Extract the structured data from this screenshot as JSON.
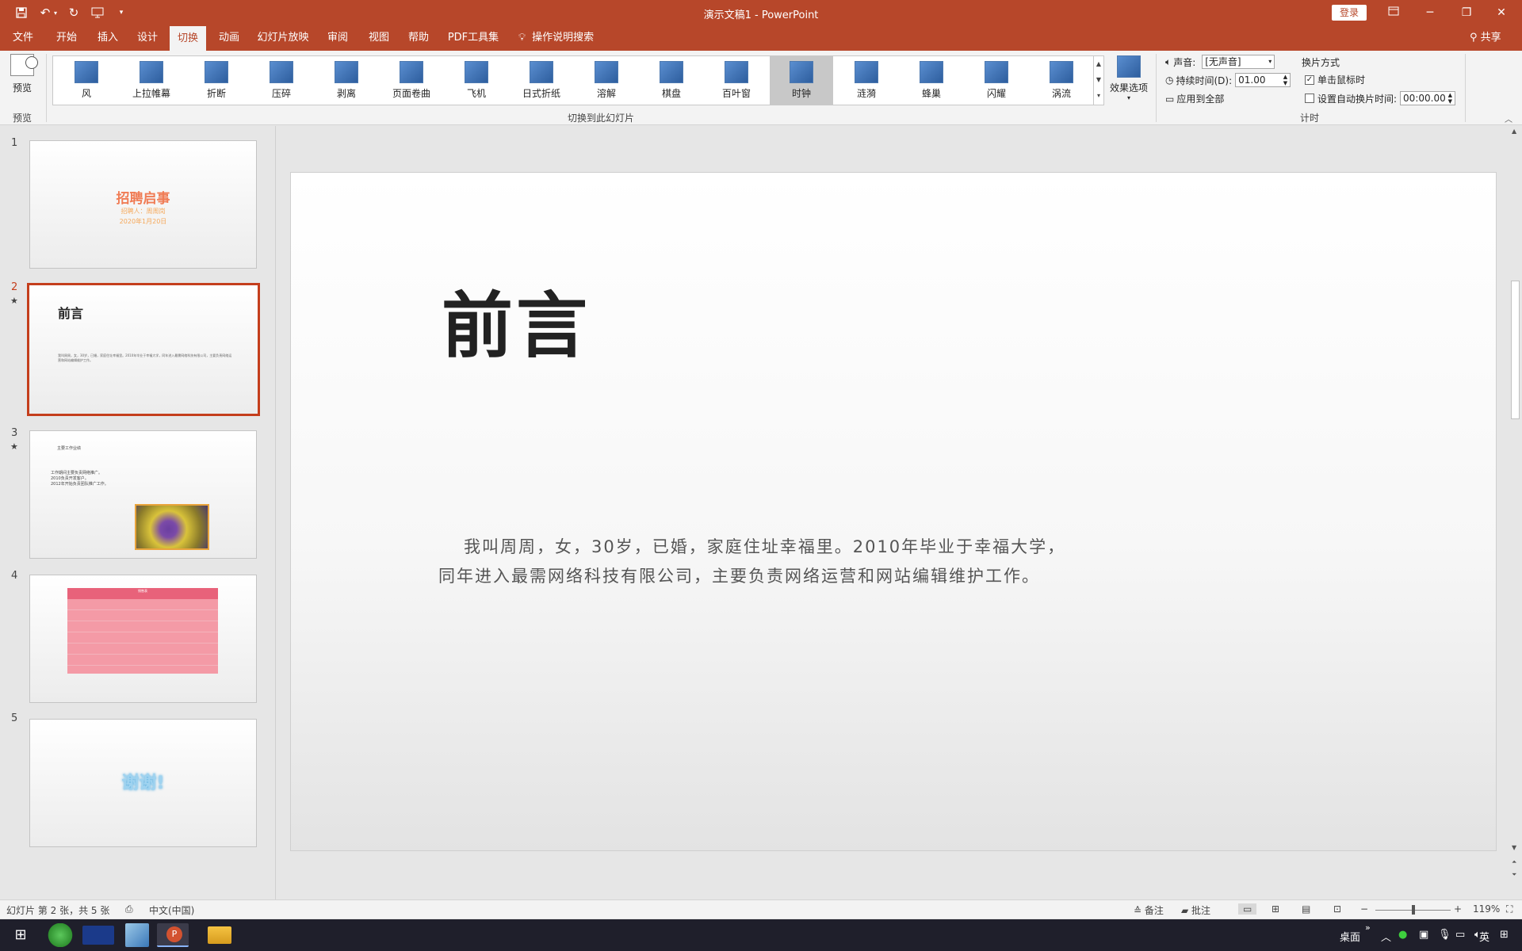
{
  "window": {
    "title": "演示文稿1 - PowerPoint",
    "login": "登录"
  },
  "tabs": [
    "文件",
    "开始",
    "插入",
    "设计",
    "切换",
    "动画",
    "幻灯片放映",
    "审阅",
    "视图",
    "帮助",
    "PDF工具集"
  ],
  "active_tab": "切换",
  "search_tab": "操作说明搜索",
  "share": "共享",
  "ribbon": {
    "preview_label": "预览",
    "preview_group": "预览",
    "transitions_group": "切换到此幻灯片",
    "timing_group": "计时",
    "transitions": [
      "风",
      "上拉帷幕",
      "折断",
      "压碎",
      "剥离",
      "页面卷曲",
      "飞机",
      "日式折纸",
      "溶解",
      "棋盘",
      "百叶窗",
      "时钟",
      "涟漪",
      "蜂巢",
      "闪耀",
      "涡流"
    ],
    "selected_transition": "时钟",
    "effect_options": "效果选项",
    "sound_label": "声音:",
    "sound_value": "[无声音]",
    "duration_label": "持续时间(D):",
    "duration_value": "01.00",
    "apply_all": "应用到全部",
    "advance_title": "换片方式",
    "on_click": "单击鼠标时",
    "after_label": "设置自动换片时间:",
    "after_value": "00:00.00"
  },
  "thumbnails": [
    {
      "num": "1",
      "title": "招聘启事",
      "sub1": "招聘人：周周岗",
      "sub2": "2020年1月20日"
    },
    {
      "num": "2",
      "title": "前言",
      "body": "我叫周周，女，30岁，已婚，家庭住址幸福里。2010年毕业于幸福大学，同年进入最需网络科技有限公司，主要负责网络运营和网站编辑维护工作。"
    },
    {
      "num": "3",
      "title": "主要工作业绩",
      "lines": [
        "工作期间主要负责网络推广。",
        "2010负责开发客户。",
        "2012年开始负责团队推广工作。"
      ]
    },
    {
      "num": "4",
      "table_title": "销售表"
    },
    {
      "num": "5",
      "title": "谢谢!"
    }
  ],
  "slide": {
    "title": "前言",
    "body_line1": "我叫周周，女，30岁，已婚，家庭住址幸福里。2010年毕业于幸福大学，",
    "body_line2": "同年进入最需网络科技有限公司，主要负责网络运营和网站编辑维护工作。"
  },
  "status": {
    "slide_info": "幻灯片 第 2 张，共 5 张",
    "language": "中文(中国)",
    "notes": "备注",
    "comments": "批注",
    "zoom": "119%"
  },
  "taskbar": {
    "desktop": "桌面",
    "ime": "英"
  }
}
